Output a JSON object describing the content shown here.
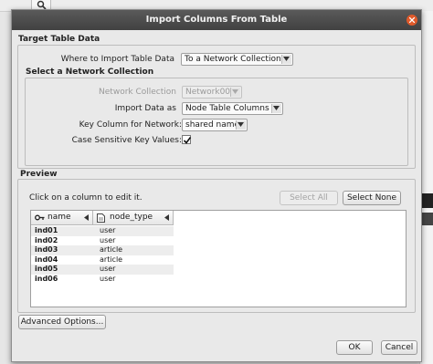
{
  "window": {
    "title": "Import Columns From Table"
  },
  "target": {
    "section_title": "Target Table Data",
    "where_label": "Where to Import Table Data",
    "where_value": "To a Network Collection",
    "collection_section_title": "Select a Network Collection",
    "network_collection_label": "Network Collection",
    "network_collection_value": "Network001",
    "import_as_label": "Import Data as",
    "import_as_value": "Node Table Columns",
    "key_column_label": "Key Column for Network:",
    "key_column_value": "shared name",
    "case_sensitive_label": "Case Sensitive Key Values:",
    "case_sensitive_checked": true
  },
  "preview": {
    "section_title": "Preview",
    "hint": "Click on a column to edit it.",
    "select_all": "Select All",
    "select_none": "Select None",
    "columns": [
      {
        "name": "name",
        "icon": "key-icon"
      },
      {
        "name": "node_type",
        "icon": "document-icon"
      }
    ],
    "rows": [
      {
        "name": "ind01",
        "node_type": "user"
      },
      {
        "name": "ind02",
        "node_type": "user"
      },
      {
        "name": "ind03",
        "node_type": "article"
      },
      {
        "name": "ind04",
        "node_type": "article"
      },
      {
        "name": "ind05",
        "node_type": "user"
      },
      {
        "name": "ind06",
        "node_type": "user"
      }
    ]
  },
  "buttons": {
    "advanced": "Advanced Options...",
    "ok": "OK",
    "cancel": "Cancel"
  },
  "colors": {
    "titlebar": "#474747",
    "close": "#e05a2b",
    "row_alt": "#ededed"
  }
}
